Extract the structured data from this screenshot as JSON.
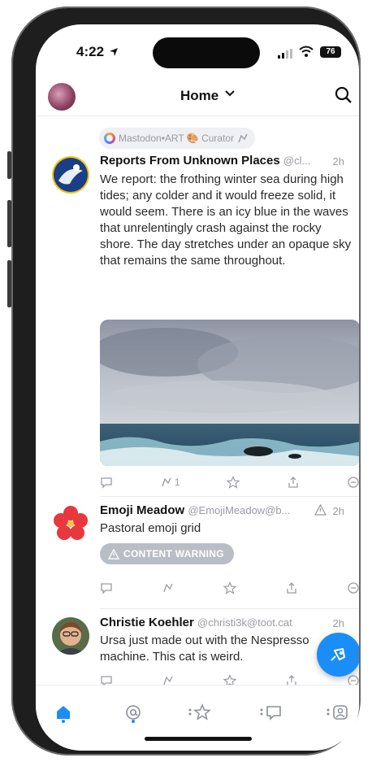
{
  "status_bar": {
    "time": "4:22",
    "battery": "76"
  },
  "header": {
    "title": "Home"
  },
  "boost_tag": {
    "label": "Mastodon•ART 🎨 Curator"
  },
  "posts": [
    {
      "name": "Reports From Unknown Places",
      "handle": "@cl...",
      "time": "2h",
      "text": "We report: the frothing winter sea during high tides; any colder and it would freeze solid, it would seem. There is an icy blue in the waves that unrelentingly crash against the rocky shore. The day stretches under an opaque sky that remains the same throughout.",
      "boost_count": "1"
    },
    {
      "name": "Emoji Meadow",
      "handle": "@EmojiMeadow@b...",
      "time": "2h",
      "text": "Pastoral emoji grid",
      "content_warning": "CONTENT WARNING"
    },
    {
      "name": "Christie Koehler",
      "handle": "@christi3k@toot.cat",
      "time": "2h",
      "text": "Ursa just made out with the Nespresso machine. This cat is weird."
    }
  ],
  "accent_color": "#1b8df6",
  "icons": [
    "location-arrow-icon",
    "signal-icon",
    "wifi-icon",
    "battery-icon",
    "chevron-down-icon",
    "search-icon",
    "reply-icon",
    "boost-icon",
    "favorite-icon",
    "share-icon",
    "translate-icon",
    "warning-icon",
    "compose-icon",
    "home-icon",
    "mention-icon",
    "explore-icon",
    "messages-icon",
    "profile-icon"
  ]
}
